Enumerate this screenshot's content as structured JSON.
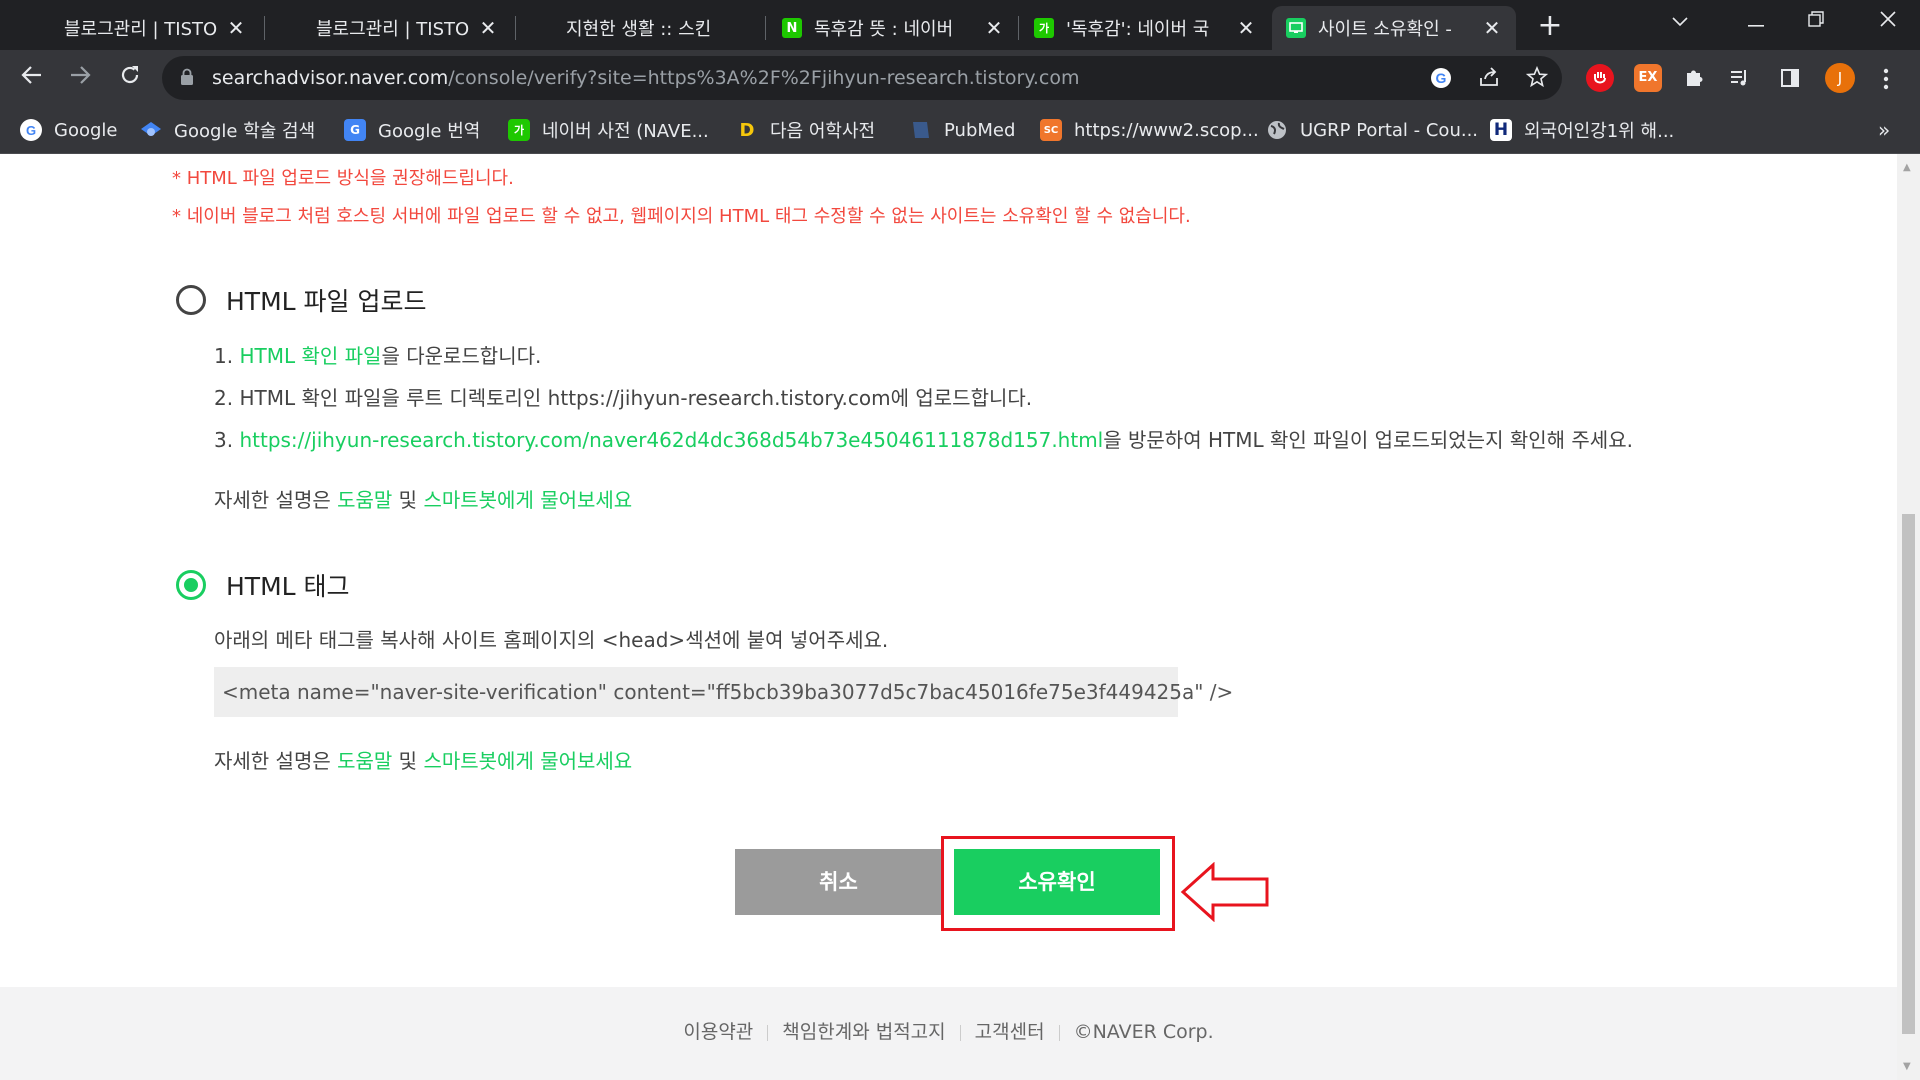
{
  "browser": {
    "tabs": [
      {
        "title": "블로그관리 | TISTORY",
        "favicon": "tistory-favicon",
        "active": false
      },
      {
        "title": "블로그관리 | TISTORY",
        "favicon": "tistory-favicon",
        "active": false
      },
      {
        "title": "지현한 생활 :: 스킨",
        "favicon": "tistory-favicon",
        "active": false
      },
      {
        "title": "독후감 뜻 : 네이버",
        "favicon": "naver-n-favicon",
        "favicon_text": "N",
        "active": false
      },
      {
        "title": "'독후감': 네이버 국",
        "favicon": "naver-dict-favicon",
        "favicon_text": "가",
        "active": false
      },
      {
        "title": "사이트 소유확인 - ",
        "favicon": "searchadvisor-favicon",
        "active": true
      }
    ],
    "new_tab_symbol": "+",
    "close_symbol": "✕",
    "url_host": "searchadvisor.naver.com",
    "url_path": "/console/verify?site=https%3A%2F%2Fjihyun-research.tistory.com",
    "profile_initial": "J",
    "ext_ex_label": "EX",
    "bookmarks": [
      {
        "label": "Google",
        "icon": "google-icon"
      },
      {
        "label": "Google 학술 검색",
        "icon": "scholar-icon"
      },
      {
        "label": "Google 번역",
        "icon": "translate-icon"
      },
      {
        "label": "네이버 사전 (NAVE...",
        "icon": "naver-dict-icon",
        "icon_text": "가"
      },
      {
        "label": "다음 어학사전",
        "icon": "daum-icon",
        "icon_text": "D"
      },
      {
        "label": "PubMed",
        "icon": "pubmed-icon"
      },
      {
        "label": "https://www2.scop...",
        "icon": "scopus-icon",
        "icon_text": "SC"
      },
      {
        "label": "UGRP Portal - Cou...",
        "icon": "globe-icon"
      },
      {
        "label": "외국어인강1위 해...",
        "icon": "hackers-icon",
        "icon_text": "H"
      }
    ],
    "bookmarks_overflow": "»"
  },
  "page": {
    "notices": [
      "* HTML 파일 업로드 방식을 권장해드립니다.",
      "* 네이버 블로그 처럼 호스팅 서버에 파일 업로드 할 수 없고, 웹페이지의 HTML 태그 수정할 수 없는 사이트는 소유확인 할 수 없습니다."
    ],
    "option_file": {
      "label": "HTML 파일 업로드",
      "selected": false,
      "step1_num": "1. ",
      "step1_link": "HTML 확인 파일",
      "step1_rest": "을 다운로드합니다.",
      "step2": "2. HTML 확인 파일을 루트 디렉토리인 https://jihyun-research.tistory.com에 업로드합니다.",
      "step3_num": "3. ",
      "step3_link": "https://jihyun-research.tistory.com/naver462d4dc368d54b73e45046111878d157.html",
      "step3_rest": "을 방문하여 HTML 확인 파일이 업로드되었는지 확인해 주세요.",
      "help_prefix": "자세한 설명은 ",
      "help_link1": "도움말",
      "help_mid": " 및 ",
      "help_link2": "스마트봇에게 물어보세요"
    },
    "option_tag": {
      "label": "HTML 태그",
      "selected": true,
      "instruction": "아래의 메타 태그를 복사해 사이트 홈페이지의 <head>섹션에 붙여 넣어주세요.",
      "meta_tag": "<meta name=\"naver-site-verification\" content=\"ff5bcb39ba3077d5c7bac45016fe75e3f449425a\" />",
      "help_prefix": "자세한 설명은 ",
      "help_link1": "도움말",
      "help_mid": " 및 ",
      "help_link2": "스마트봇에게 물어보세요"
    },
    "cancel_label": "취소",
    "confirm_label": "소유확인",
    "footer": [
      "이용약관",
      "책임한계와 법적고지",
      "고객센터",
      "©NAVER Corp."
    ]
  },
  "colors": {
    "naver_green": "#19ce60",
    "notice_red": "#f2483e",
    "highlight_red": "#e8141e"
  }
}
